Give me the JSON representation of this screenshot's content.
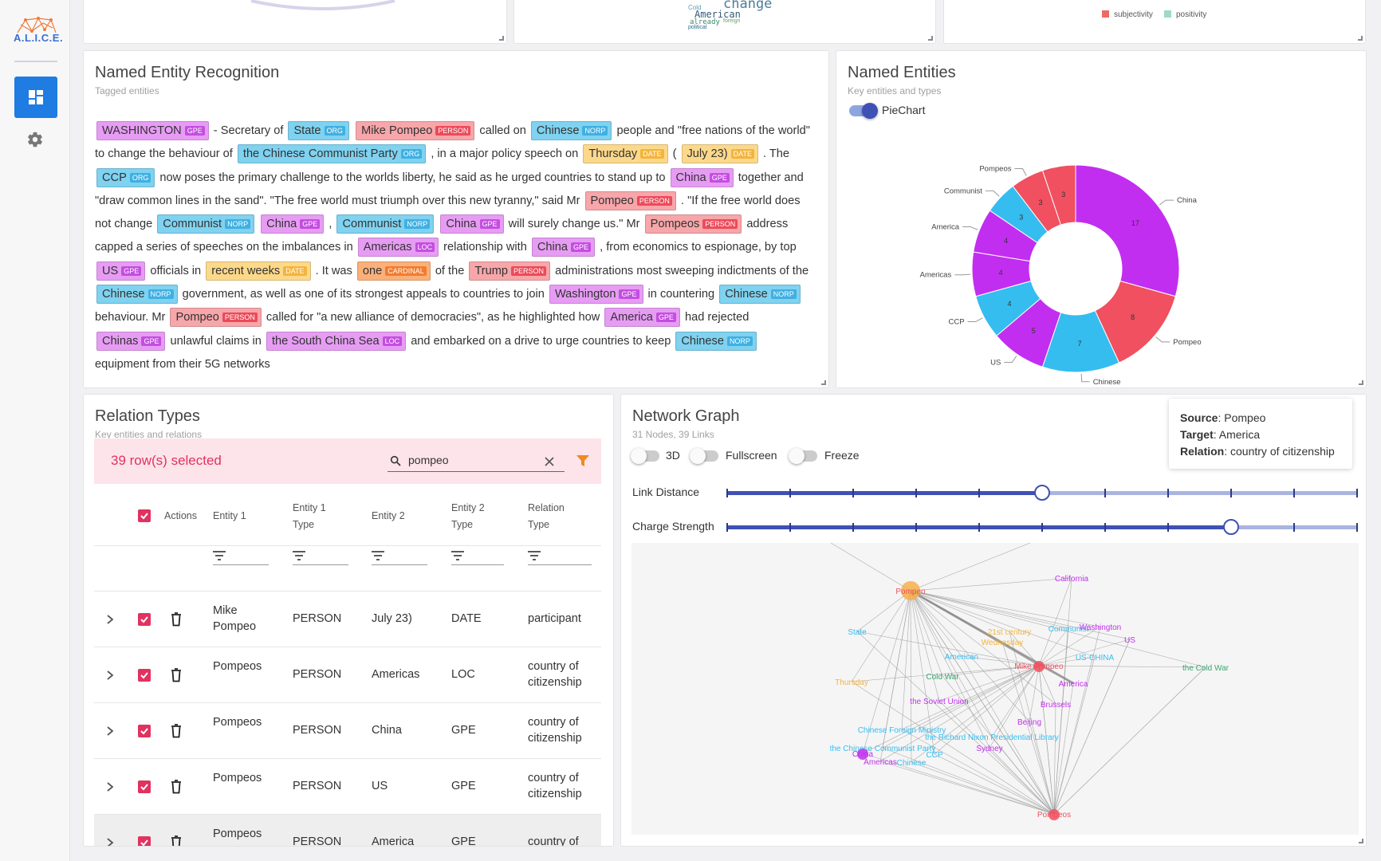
{
  "brand": {
    "logo_text": "A.L.I.C.E."
  },
  "top_cards": {
    "legend": [
      {
        "label": "subjectivity",
        "color": "#ec6b63"
      },
      {
        "label": "positivity",
        "color": "#9fd9c8"
      }
    ],
    "wordcloud": [
      "change",
      "American",
      "Cold",
      "already",
      "foreign",
      "political"
    ]
  },
  "ner": {
    "title": "Named Entity Recognition",
    "subtitle": "Tagged entities",
    "segments": [
      {
        "e": "WASHINGTON",
        "t": "GPE"
      },
      " - Secretary of ",
      {
        "e": "State",
        "t": "ORG"
      },
      " ",
      {
        "e": "Mike Pompeo",
        "t": "PERSON"
      },
      " called on ",
      {
        "e": "Chinese",
        "t": "NORP"
      },
      " people and \"free nations of the world\" to change the behaviour of ",
      {
        "e": "the Chinese Communist Party",
        "t": "ORG"
      },
      " , in a major policy speech on ",
      {
        "e": "Thursday",
        "t": "DATE"
      },
      " ( ",
      {
        "e": "July 23)",
        "t": "DATE"
      },
      " . The ",
      {
        "e": "CCP",
        "t": "ORG"
      },
      " now poses the primary challenge to the worlds liberty, he said as he urged countries to stand up to ",
      {
        "e": "China",
        "t": "GPE"
      },
      " together and \"draw common lines in the sand\". \"The free world must triumph over this new tyranny,\" said Mr ",
      {
        "e": "Pompeo",
        "t": "PERSON"
      },
      " . \"If the free world does not change ",
      {
        "e": "Communist",
        "t": "NORP"
      },
      " ",
      {
        "e": "China",
        "t": "GPE"
      },
      " , ",
      {
        "e": "Communist",
        "t": "NORP"
      },
      " ",
      {
        "e": "China",
        "t": "GPE"
      },
      " will surely change us.\" Mr ",
      {
        "e": "Pompeos",
        "t": "PERSON"
      },
      " address capped a series of speeches on the imbalances in ",
      {
        "e": "Americas",
        "t": "LOC"
      },
      " relationship with ",
      {
        "e": "China",
        "t": "GPE"
      },
      " , from economics to espionage, by top ",
      {
        "e": "US",
        "t": "GPE"
      },
      " officials in ",
      {
        "e": "recent weeks",
        "t": "DATE"
      },
      " . It was ",
      {
        "e": "one",
        "t": "CARDINAL"
      },
      " of the ",
      {
        "e": "Trump",
        "t": "PERSON"
      },
      " administrations most sweeping indictments of the ",
      {
        "e": "Chinese",
        "t": "NORP"
      },
      " government, as well as one of its strongest appeals to countries to join ",
      {
        "e": "Washington",
        "t": "GPE"
      },
      " in countering ",
      {
        "e": "Chinese",
        "t": "NORP"
      },
      " behaviour. Mr ",
      {
        "e": "Pompeo",
        "t": "PERSON"
      },
      " called for \"a new alliance of democracies\", as he highlighted how ",
      {
        "e": "America",
        "t": "GPE"
      },
      " had rejected ",
      {
        "e": "Chinas",
        "t": "GPE"
      },
      " unlawful claims in ",
      {
        "e": "the South China Sea",
        "t": "LOC"
      },
      " and embarked on a drive to urge countries to keep ",
      {
        "e": "Chinese",
        "t": "NORP"
      },
      " equipment from their 5G networks"
    ]
  },
  "entities": {
    "title": "Named Entities",
    "subtitle": "Key entities and types",
    "toggle_label": "PieChart",
    "toggle_on": true
  },
  "chart_data": {
    "type": "pie",
    "donut": true,
    "slices": [
      {
        "label": "China",
        "value": 17,
        "color": "#c22ef0"
      },
      {
        "label": "Pompeo",
        "value": 8,
        "color": "#f0505f"
      },
      {
        "label": "Chinese",
        "value": 7,
        "color": "#35bdf0"
      },
      {
        "label": "US",
        "value": 5,
        "color": "#c22ef0"
      },
      {
        "label": "CCP",
        "value": 4,
        "color": "#35bdf0"
      },
      {
        "label": "Americas",
        "value": 4,
        "color": "#c22ef0"
      },
      {
        "label": "America",
        "value": 4,
        "color": "#c22ef0"
      },
      {
        "label": "Communist",
        "value": 3,
        "color": "#35bdf0"
      },
      {
        "label": "Pompeos",
        "value": 3,
        "color": "#f0505f"
      },
      {
        "label": "",
        "value": 3,
        "color": "#f0505f"
      }
    ]
  },
  "relations": {
    "title": "Relation Types",
    "subtitle": "Key entities and relations",
    "selected_text": "39 row(s) selected",
    "search_value": "pompeo",
    "headers": {
      "actions": "Actions",
      "e1": "Entity 1",
      "e1t": "Entity 1 Type",
      "e2": "Entity 2",
      "e2t": "Entity 2 Type",
      "rel": "Relation Type"
    },
    "rows": [
      {
        "e1": "Mike Pompeo",
        "e1t": "PERSON",
        "e2": "July 23)",
        "e2t": "DATE",
        "rel": "participant"
      },
      {
        "e1": "Pompeos",
        "e1t": "PERSON",
        "e2": "Americas",
        "e2t": "LOC",
        "rel": "country of citizenship"
      },
      {
        "e1": "Pompeos",
        "e1t": "PERSON",
        "e2": "China",
        "e2t": "GPE",
        "rel": "country of citizenship"
      },
      {
        "e1": "Pompeos",
        "e1t": "PERSON",
        "e2": "US",
        "e2t": "GPE",
        "rel": "country of citizenship"
      },
      {
        "e1": "Pompeos",
        "e1t": "PERSON",
        "e2": "America",
        "e2t": "GPE",
        "rel": "country of"
      }
    ]
  },
  "network": {
    "title": "Network Graph",
    "subtitle": "31 Nodes, 39 Links",
    "toggles": [
      {
        "label": "3D",
        "on": false
      },
      {
        "label": "Fullscreen",
        "on": false
      },
      {
        "label": "Freeze",
        "on": false
      }
    ],
    "sliders": [
      {
        "label": "Link Distance",
        "value": 0.5
      },
      {
        "label": "Charge Strength",
        "value": 0.8
      }
    ],
    "tooltip": {
      "source_label": "Source",
      "source": "Pompeo",
      "target_label": "Target",
      "target": "America",
      "relation_label": "Relation",
      "relation": "country of citizenship"
    },
    "nodes": [
      {
        "label": "Pompeo",
        "color": "#f0505f"
      },
      {
        "label": "California",
        "color": "#c22ef0"
      },
      {
        "label": "State",
        "color": "#35bdf0"
      },
      {
        "label": "21st century",
        "color": "#f4b43c"
      },
      {
        "label": "Communist",
        "color": "#35bdf0"
      },
      {
        "label": "Washington",
        "color": "#c22ef0"
      },
      {
        "label": "US",
        "color": "#c22ef0"
      },
      {
        "label": "Wednesday",
        "color": "#f4b43c"
      },
      {
        "label": "American",
        "color": "#35bdf0"
      },
      {
        "label": "US-CHINA",
        "color": "#35bdf0"
      },
      {
        "label": "Mike Pompeo",
        "color": "#f0505f"
      },
      {
        "label": "the Cold War",
        "color": "#3aa66e"
      },
      {
        "label": "Thursday",
        "color": "#f4b43c"
      },
      {
        "label": "Cold War",
        "color": "#3aa66e"
      },
      {
        "label": "America",
        "color": "#c22ef0"
      },
      {
        "label": "the Soviet Union",
        "color": "#c22ef0"
      },
      {
        "label": "Brussels",
        "color": "#c22ef0"
      },
      {
        "label": "Beijing",
        "color": "#c22ef0"
      },
      {
        "label": "Chinese Foreign Ministry",
        "color": "#35bdf0"
      },
      {
        "label": "the Richard Nixon Presidential Library",
        "color": "#35bdf0"
      },
      {
        "label": "the Chinese Communist Party",
        "color": "#35bdf0"
      },
      {
        "label": "Sydney",
        "color": "#c22ef0"
      },
      {
        "label": "CCP",
        "color": "#35bdf0"
      },
      {
        "label": "China",
        "color": "#c22ef0"
      },
      {
        "label": "Americas",
        "color": "#c22ef0"
      },
      {
        "label": "Chinese",
        "color": "#35bdf0"
      },
      {
        "label": "Pompeos",
        "color": "#f0505f"
      }
    ]
  }
}
